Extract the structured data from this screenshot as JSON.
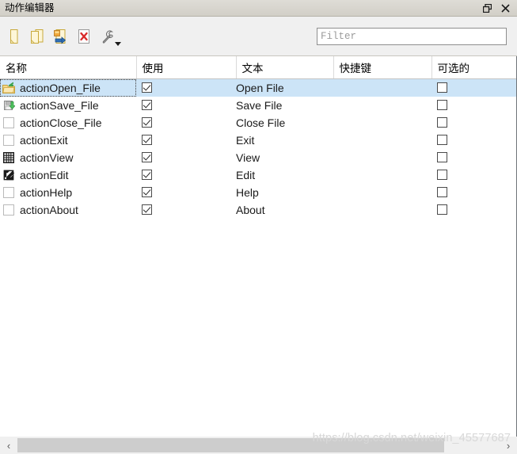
{
  "window": {
    "title": "动作编辑器",
    "controls": [
      {
        "name": "float-icon",
        "label": "❐"
      },
      {
        "name": "close-icon",
        "label": "✕"
      }
    ]
  },
  "toolbar": {
    "buttons": [
      {
        "name": "new-action-button",
        "icon": "new-file-icon",
        "tooltip": "新建"
      },
      {
        "name": "copy-action-button",
        "icon": "copy-file-icon",
        "tooltip": "复制"
      },
      {
        "name": "edit-action-button",
        "icon": "edit-file-icon",
        "tooltip": "编辑"
      },
      {
        "name": "delete-action-button",
        "icon": "delete-file-icon",
        "tooltip": "删除"
      },
      {
        "name": "settings-button",
        "icon": "wrench-icon",
        "tooltip": "设置",
        "has_dropdown": true
      }
    ],
    "filter": {
      "placeholder": "Filter",
      "value": ""
    }
  },
  "table": {
    "columns": [
      {
        "key": "name",
        "label": "名称"
      },
      {
        "key": "used",
        "label": "使用"
      },
      {
        "key": "text",
        "label": "文本"
      },
      {
        "key": "shortcut",
        "label": "快捷键"
      },
      {
        "key": "checkable",
        "label": "可选的"
      }
    ],
    "rows": [
      {
        "icon": "open-folder-icon",
        "name": "actionOpen_File",
        "used": true,
        "text": "Open File",
        "shortcut": "",
        "checkable": false,
        "selected": true
      },
      {
        "icon": "save-disk-icon",
        "name": "actionSave_File",
        "used": true,
        "text": "Save File",
        "shortcut": "",
        "checkable": false,
        "selected": false
      },
      {
        "icon": "blank-icon",
        "name": "actionClose_File",
        "used": true,
        "text": "Close File",
        "shortcut": "",
        "checkable": false,
        "selected": false
      },
      {
        "icon": "blank-icon",
        "name": "actionExit",
        "used": true,
        "text": "Exit",
        "shortcut": "",
        "checkable": false,
        "selected": false
      },
      {
        "icon": "grid-table-icon",
        "name": "actionView",
        "used": true,
        "text": "View",
        "shortcut": "",
        "checkable": false,
        "selected": false
      },
      {
        "icon": "edit-pencil-icon",
        "name": "actionEdit",
        "used": true,
        "text": "Edit",
        "shortcut": "",
        "checkable": false,
        "selected": false
      },
      {
        "icon": "blank-icon",
        "name": "actionHelp",
        "used": true,
        "text": "Help",
        "shortcut": "",
        "checkable": false,
        "selected": false
      },
      {
        "icon": "blank-icon",
        "name": "actionAbout",
        "used": true,
        "text": "About",
        "shortcut": "",
        "checkable": false,
        "selected": false
      }
    ]
  },
  "scrollbar": {
    "left_arrow": "‹",
    "right_arrow": "›"
  },
  "watermark": {
    "text": "https://blog.csdn.net/weixin_45577687"
  },
  "colors": {
    "selection": "#cce4f7",
    "titlebar": "#d4d0c8",
    "toolbar": "#f0f0f0",
    "grid_border": "#dadada"
  }
}
